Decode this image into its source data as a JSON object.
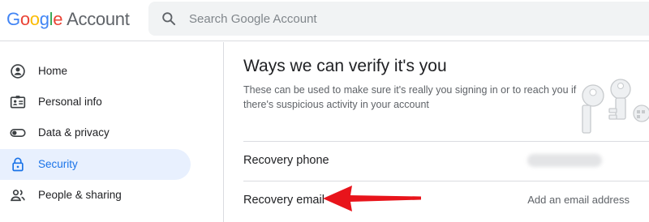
{
  "header": {
    "logo_word": "Google",
    "product_name": "Account",
    "search": {
      "placeholder": "Search Google Account",
      "value": "",
      "icon": "search-icon"
    }
  },
  "sidebar": {
    "items": [
      {
        "label": "Home",
        "icon": "home-icon",
        "active": false
      },
      {
        "label": "Personal info",
        "icon": "id-card-icon",
        "active": false
      },
      {
        "label": "Data & privacy",
        "icon": "toggle-icon",
        "active": false
      },
      {
        "label": "Security",
        "icon": "lock-icon",
        "active": true
      },
      {
        "label": "People & sharing",
        "icon": "people-icon",
        "active": false
      }
    ]
  },
  "main": {
    "title": "Ways we can verify it's you",
    "description": "These can be used to make sure it's really you signing in or to reach you if there's suspicious activity in your account",
    "rows": [
      {
        "label": "Recovery phone",
        "value_hidden": true
      },
      {
        "label": "Recovery email",
        "value": "Add an email address"
      }
    ]
  },
  "annotation": {
    "type": "arrow",
    "color": "#e8141b",
    "points_to": "Recovery email"
  },
  "colors": {
    "accent": "#1a73e8",
    "active_nav_bg": "#e8f0fe",
    "search_bg": "#f1f3f4",
    "divider": "#dadce0",
    "secondary_text": "#5f6368"
  }
}
